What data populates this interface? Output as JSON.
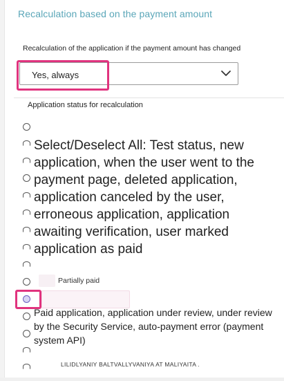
{
  "section": {
    "title": "Recalculation based on the payment amount"
  },
  "recalc_field": {
    "label": "Recalculation of the application if the payment amount has changed",
    "selected_value": "Yes, always",
    "icon": "chevron-down-icon"
  },
  "status_field": {
    "label": "Application status for recalculation",
    "select_all_text": "Select/Deselect All: Test status, new application, when the user went to the payment page, deleted application, application canceled by the user, erroneous application, application awaiting verification, user marked application as paid",
    "partially_paid_label": "Partially paid",
    "group_text": "Paid application, application under review, under review by the Security Service, auto-payment error (payment system API)",
    "bottom_caption": "LILIDLYANIY BALTVALLYVANIYA AT MALIYAITA ."
  },
  "colors": {
    "accent_teal": "#5aa6b8",
    "highlight_pink": "#e0337e"
  }
}
